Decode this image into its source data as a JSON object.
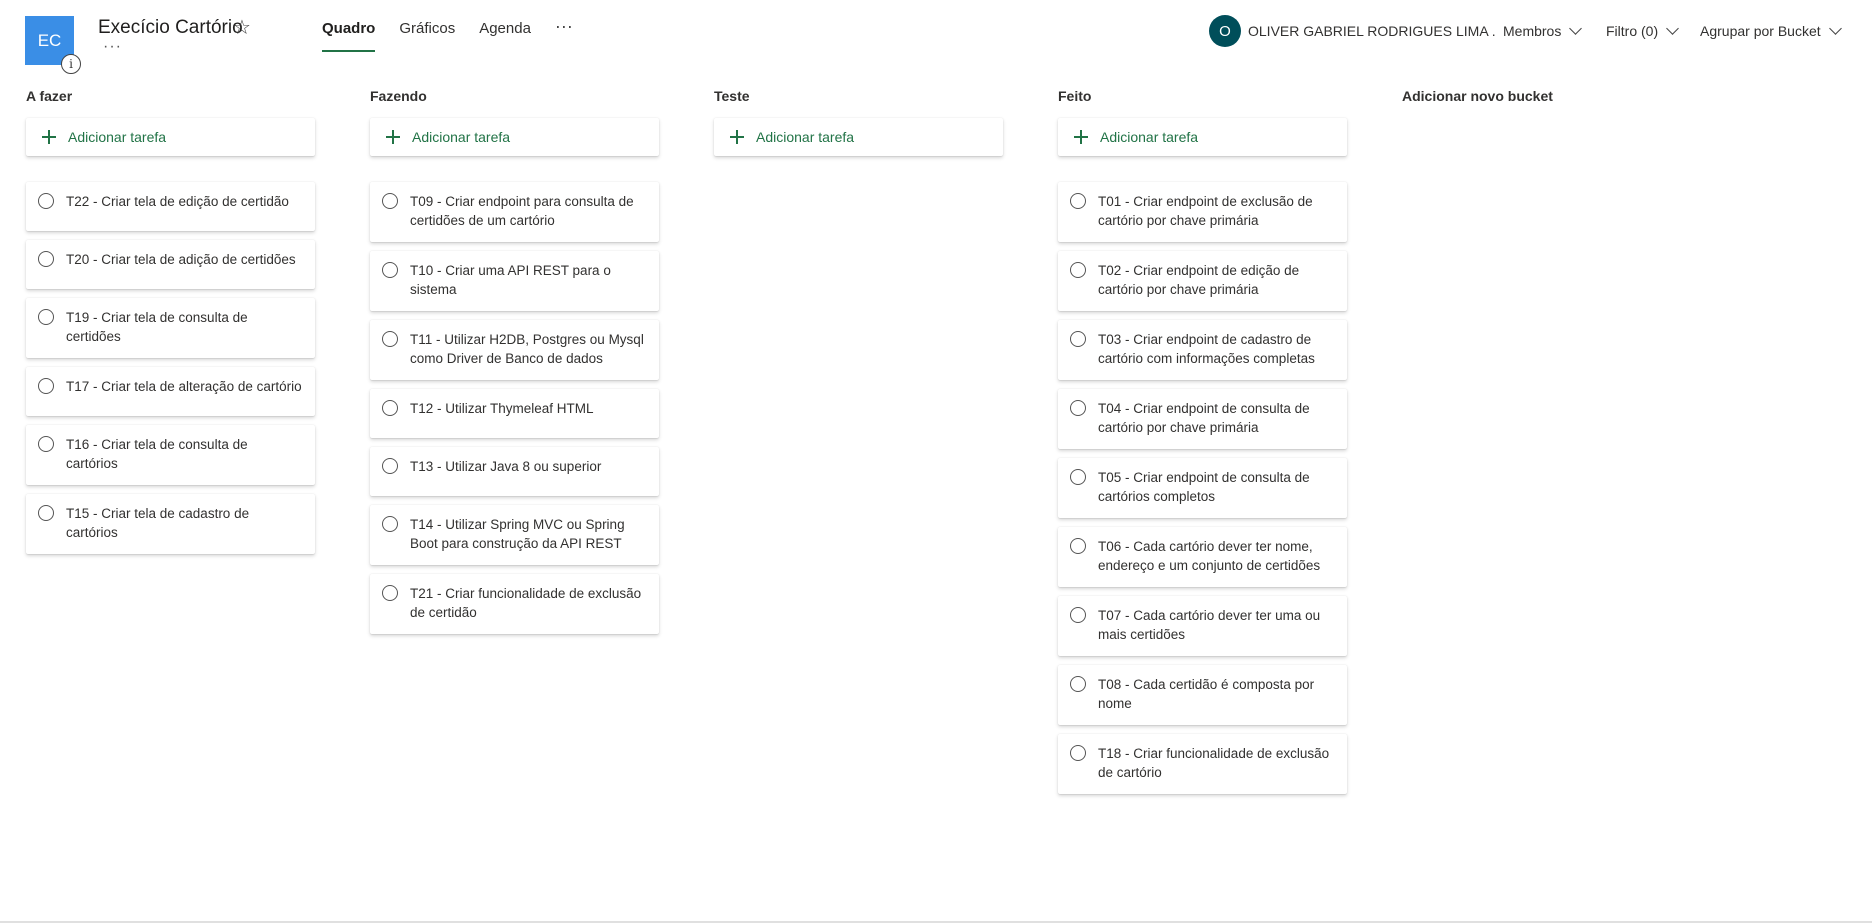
{
  "header": {
    "plan_initials": "EC",
    "plan_title": "Execício Cartório",
    "tabs": [
      {
        "label": "Quadro",
        "active": true
      },
      {
        "label": "Gráficos",
        "active": false
      },
      {
        "label": "Agenda",
        "active": false
      }
    ],
    "user_initial": "O",
    "user_name": "OLIVER GABRIEL RODRIGUES LIMA .",
    "members_label": "Membros",
    "filter_label": "Filtro (0)",
    "group_label": "Agrupar por Bucket"
  },
  "add_task_label": "Adicionar tarefa",
  "new_bucket_label": "Adicionar novo bucket",
  "buckets": [
    {
      "name": "A fazer",
      "tasks": [
        "T22 - Criar tela de edição de certidão",
        "T20 - Criar tela de adição de certidões",
        "T19 - Criar tela de consulta de certidões",
        "T17 - Criar tela de alteração de cartório",
        "T16 - Criar tela de consulta de cartórios",
        "T15 - Criar tela de cadastro de cartórios"
      ]
    },
    {
      "name": "Fazendo",
      "tasks": [
        "T09 - Criar endpoint para consulta de certidões de um cartório",
        "T10 - Criar uma API REST para o sistema",
        "T11 - Utilizar H2DB, Postgres ou Mysql como Driver de Banco de dados",
        "T12 - Utilizar Thymeleaf HTML",
        "T13 - Utilizar Java 8 ou superior",
        "T14 - Utilizar Spring MVC ou Spring Boot para construção da API REST",
        "T21 - Criar funcionalidade de exclusão de certidão"
      ]
    },
    {
      "name": "Teste",
      "tasks": []
    },
    {
      "name": "Feito",
      "tasks": [
        "T01 - Criar endpoint de exclusão de cartório por chave primária",
        "T02 - Criar endpoint de edição de cartório por chave primária",
        "T03 - Criar endpoint de cadastro de cartório com informações completas",
        "T04 - Criar endpoint de consulta de cartório por chave primária",
        "T05 - Criar endpoint de consulta de cartórios completos",
        "T06 - Cada cartório dever ter nome, endereço e um conjunto de certidões",
        "T07 - Cada cartório dever ter uma ou mais certidões",
        "T08 - Cada certidão é composta por nome",
        "T18 - Criar funcionalidade de exclusão de cartório"
      ]
    }
  ],
  "colors": {
    "accent": "#217346",
    "plan_icon": "#3a8ee6",
    "avatar": "#004e5a"
  }
}
